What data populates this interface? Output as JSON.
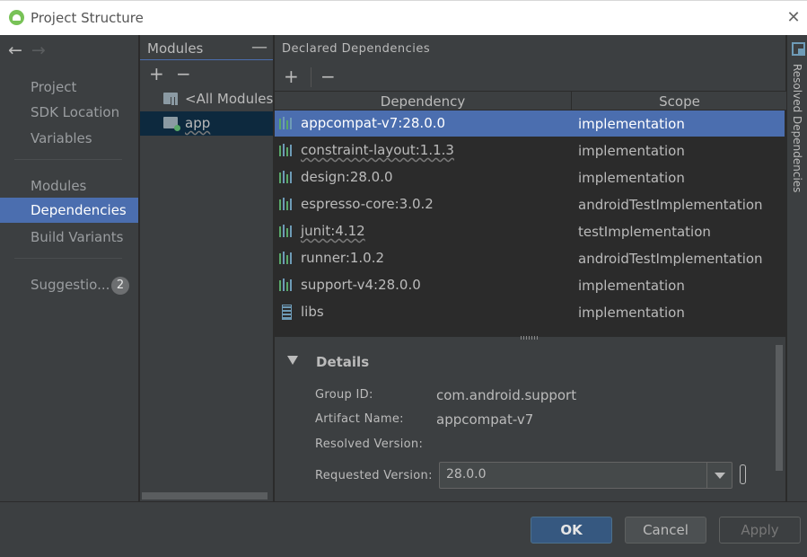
{
  "window": {
    "title": "Project Structure",
    "icon": "android-studio-icon"
  },
  "nav": {
    "items": [
      {
        "label": "Project"
      },
      {
        "label": "SDK Location"
      },
      {
        "label": "Variables"
      },
      {
        "label": "Modules"
      },
      {
        "label": "Dependencies",
        "selected": true
      },
      {
        "label": "Build Variants"
      },
      {
        "label": "Suggestio..."
      }
    ],
    "suggestions_badge": "2"
  },
  "modules": {
    "header": "Modules",
    "items": [
      {
        "label": "<All Modules>"
      },
      {
        "label": "app",
        "selected": true
      }
    ]
  },
  "dependencies": {
    "header": "Declared Dependencies",
    "columns": {
      "dependency": "Dependency",
      "scope": "Scope"
    },
    "rows": [
      {
        "name": "appcompat-v7:28.0.0",
        "scope": "implementation",
        "selected": true
      },
      {
        "name": "constraint-layout:1.1.3",
        "scope": "implementation"
      },
      {
        "name": "design:28.0.0",
        "scope": "implementation"
      },
      {
        "name": "espresso-core:3.0.2",
        "scope": "androidTestImplementation"
      },
      {
        "name": "junit:4.12",
        "scope": "testImplementation"
      },
      {
        "name": "runner:1.0.2",
        "scope": "androidTestImplementation"
      },
      {
        "name": "support-v4:28.0.0",
        "scope": "implementation"
      },
      {
        "name": "libs",
        "scope": "implementation"
      }
    ]
  },
  "details": {
    "title": "Details",
    "group_id_label": "Group ID:",
    "group_id": "com.android.support",
    "artifact_name_label": "Artifact Name:",
    "artifact_name": "appcompat-v7",
    "resolved_version_label": "Resolved Version:",
    "requested_version_label": "Requested Version:",
    "requested_version": "28.0.0"
  },
  "side_tab": "Resolved Dependencies",
  "buttons": {
    "ok": "OK",
    "cancel": "Cancel",
    "apply": "Apply"
  },
  "colors": {
    "selection": "#4b6eaf",
    "panel": "#3c3f41",
    "background": "#2b2b2b"
  }
}
